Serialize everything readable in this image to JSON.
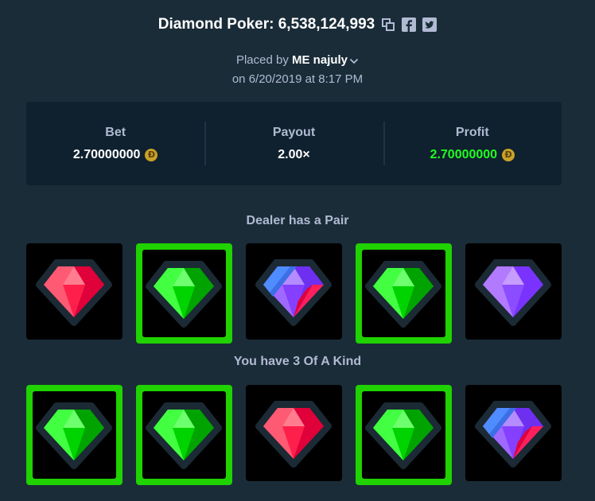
{
  "header": {
    "title": "Diamond Poker: 6,538,124,993",
    "placed_prefix": "Placed by",
    "username": "ME najuly",
    "date": "on 6/20/2019 at 8:17 PM"
  },
  "stats": {
    "bet_label": "Bet",
    "bet_value": "2.70000000",
    "payout_label": "Payout",
    "payout_value": "2.00×",
    "profit_label": "Profit",
    "profit_value": "2.70000000",
    "currency_symbol": "Ð"
  },
  "dealer": {
    "label": "Dealer has a Pair",
    "gems": [
      {
        "gem": "red",
        "highlight": false
      },
      {
        "gem": "green",
        "highlight": true
      },
      {
        "gem": "blue-purple",
        "highlight": false
      },
      {
        "gem": "green",
        "highlight": true
      },
      {
        "gem": "purple",
        "highlight": false
      }
    ]
  },
  "player": {
    "label": "You have 3 Of A Kind",
    "gems": [
      {
        "gem": "green",
        "highlight": true
      },
      {
        "gem": "green",
        "highlight": true
      },
      {
        "gem": "red",
        "highlight": false
      },
      {
        "gem": "green",
        "highlight": true
      },
      {
        "gem": "blue-purple",
        "highlight": false
      }
    ]
  },
  "colors": {
    "background": "#1a2c38",
    "panel": "#0f212e",
    "profit_green": "#1fff20",
    "highlight_green": "#1fd200"
  }
}
